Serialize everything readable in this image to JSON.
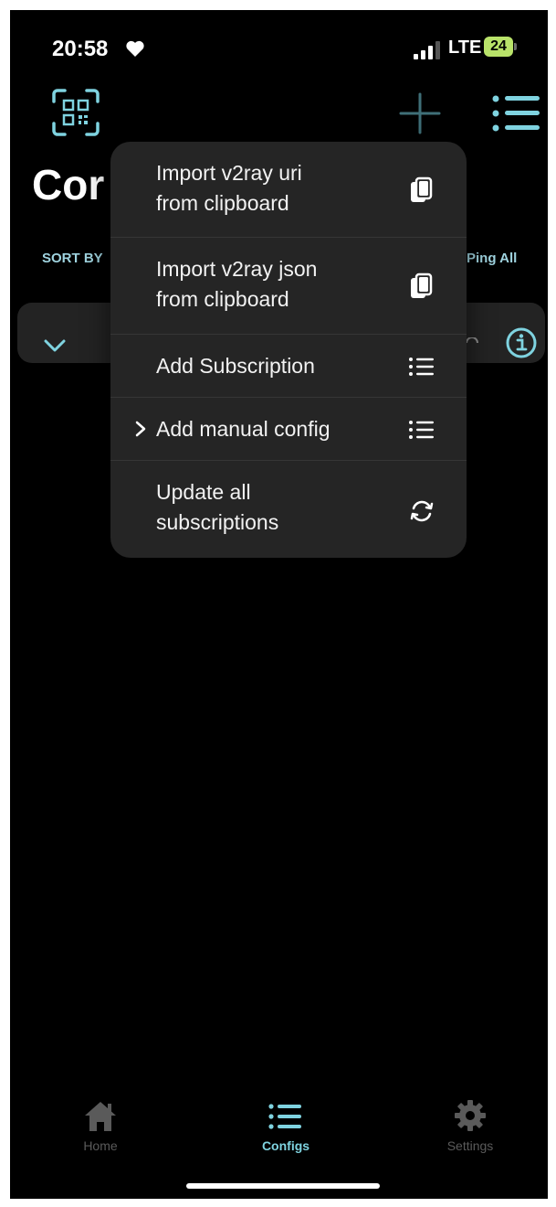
{
  "status_bar": {
    "time": "20:58",
    "network": "LTE",
    "battery": "24"
  },
  "header": {
    "title": "Cor",
    "sort_label": "SORT BY",
    "ping_all": "Ping All"
  },
  "menu": {
    "items": [
      {
        "label_line1": "Import v2ray uri",
        "label_line2": "from clipboard",
        "icon": "clipboard-icon"
      },
      {
        "label_line1": "Import v2ray json",
        "label_line2": "from clipboard",
        "icon": "clipboard-icon"
      },
      {
        "label_line1": "Add Subscription",
        "label_line2": "",
        "icon": "list-icon"
      },
      {
        "label_line1": "Add manual config",
        "label_line2": "",
        "icon": "list-icon",
        "has_submenu": true
      },
      {
        "label_line1": "Update all",
        "label_line2": "subscriptions",
        "icon": "refresh-icon"
      }
    ]
  },
  "tabbar": {
    "home": "Home",
    "configs": "Configs",
    "settings": "Settings",
    "active": "configs"
  },
  "colors": {
    "accent": "#7fd3e0",
    "background": "#000000",
    "menu_bg": "#252525",
    "card_bg": "#232323",
    "inactive": "#5a5a5a"
  }
}
